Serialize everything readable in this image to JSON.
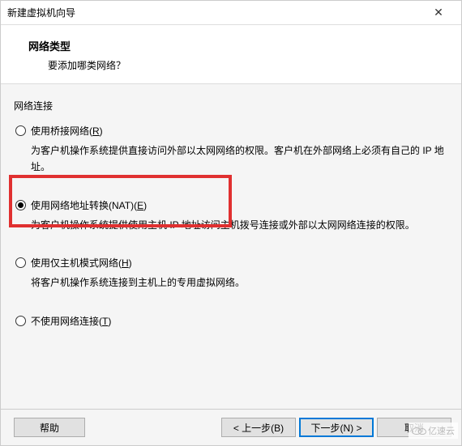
{
  "dialog": {
    "title": "新建虚拟机向导",
    "close": "✕"
  },
  "header": {
    "title": "网络类型",
    "subtitle": "要添加哪类网络？"
  },
  "fieldset": {
    "legend": "网络连接"
  },
  "options": {
    "bridge": {
      "label_prefix": "使用桥接网络(",
      "label_key": "R",
      "label_suffix": ")",
      "desc": "为客户机操作系统提供直接访问外部以太网网络的权限。客户机在外部网络上必须有自己的 IP 地址。"
    },
    "nat": {
      "label_prefix": "使用网络地址转换(NAT)(",
      "label_key": "E",
      "label_suffix": ")",
      "desc": "为客户机操作系统提供使用主机 IP 地址访问主机拨号连接或外部以太网网络连接的权限。"
    },
    "hostonly": {
      "label_prefix": "使用仅主机模式网络(",
      "label_key": "H",
      "label_suffix": ")",
      "desc": "将客户机操作系统连接到主机上的专用虚拟网络。"
    },
    "none": {
      "label_prefix": "不使用网络连接(",
      "label_key": "T",
      "label_suffix": ")"
    }
  },
  "buttons": {
    "help": "帮助",
    "back": "< 上一步(B)",
    "next": "下一步(N) >",
    "cancel": "取消"
  },
  "watermark": {
    "text": "亿速云"
  }
}
